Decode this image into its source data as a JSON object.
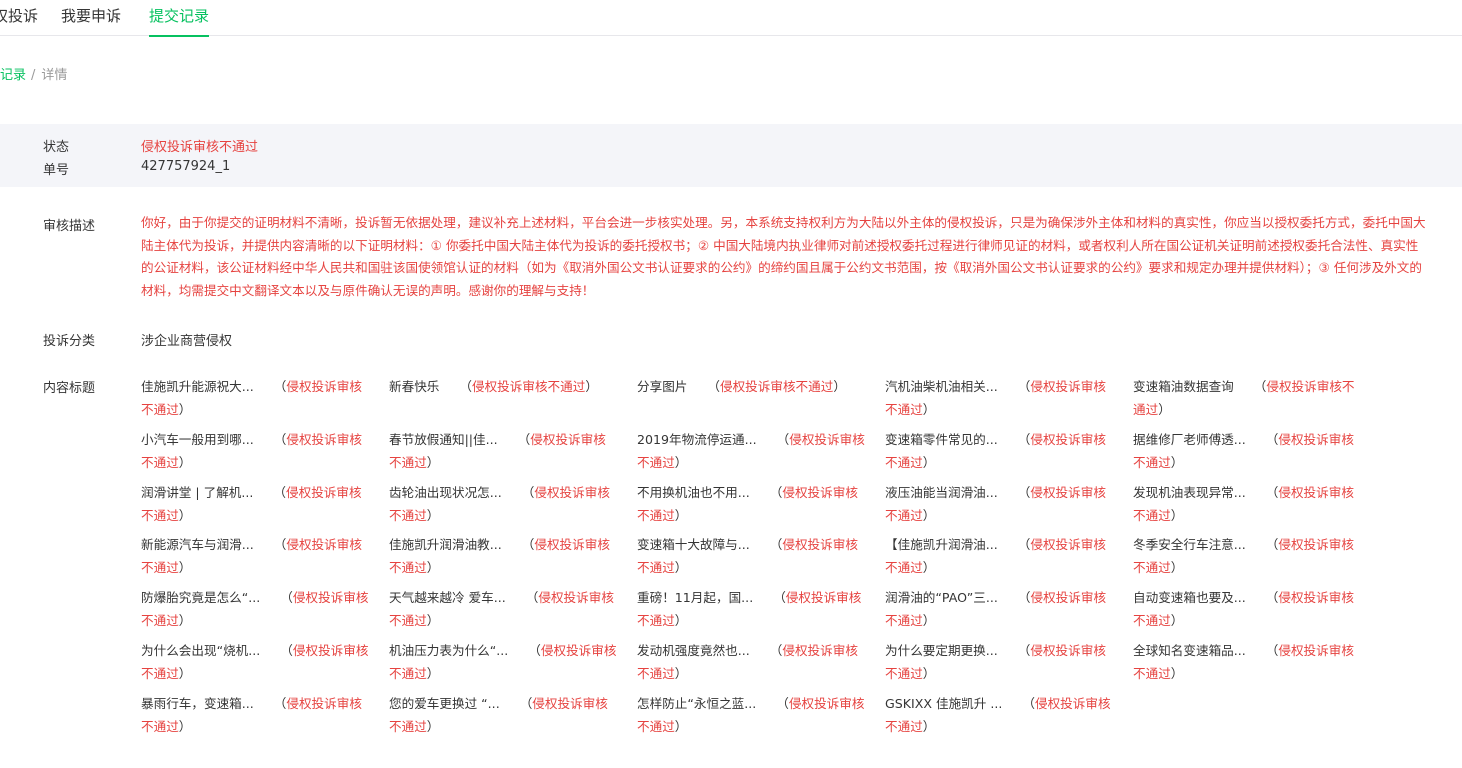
{
  "tabs": [
    {
      "label": "侵权投诉"
    },
    {
      "label": "我要申诉"
    },
    {
      "label": "提交记录"
    }
  ],
  "breadcrumb": {
    "parent": "提交记录",
    "sep": "/",
    "current": "详情"
  },
  "status": {
    "state_label": "状态",
    "state_value": "侵权投诉审核不通过",
    "number_label": "单号",
    "number_value": "427757924_1"
  },
  "review": {
    "label": "审核描述",
    "text": "你好，由于你提交的证明材料不清晰，投诉暂无依据处理，建议补充上述材料，平台会进一步核实处理。另，本系统支持权利方为大陆以外主体的侵权投诉，只是为确保涉外主体和材料的真实性，你应当以授权委托方式，委托中国大陆主体代为投诉，并提供内容清晰的以下证明材料：① 你委托中国大陆主体代为投诉的委托授权书；② 中国大陆境内执业律师对前述授权委托过程进行律师见证的材料，或者权利人所在国公证机关证明前述授权委托合法性、真实性的公证材料，该公证材料经中华人民共和国驻该国使领馆认证的材料（如为《取消外国公文书认证要求的公约》的缔约国且属于公约文书范围，按《取消外国公文书认证要求的公约》要求和规定办理并提供材料）；③ 任何涉及外文的材料，均需提交中文翻译文本以及与原件确认无误的声明。感谢你的理解与支持！"
  },
  "category": {
    "label": "投诉分类",
    "value": "涉企业商营侵权"
  },
  "titles": {
    "label": "内容标题",
    "open_paren": "（",
    "close_paren": "）",
    "items": [
      {
        "name": "佳施凯升能源祝大...",
        "status": "侵权投诉审核不通过"
      },
      {
        "name": "新春快乐",
        "status": "侵权投诉审核不通过"
      },
      {
        "name": "分享图片",
        "status": "侵权投诉审核不通过"
      },
      {
        "name": "汽机油柴机油相关...",
        "status": "侵权投诉审核不通过"
      },
      {
        "name": "变速箱油数据查询",
        "status": "侵权投诉审核不通过"
      },
      {
        "name": "小汽车一般用到哪...",
        "status": "侵权投诉审核不通过"
      },
      {
        "name": "春节放假通知||佳...",
        "status": "侵权投诉审核不通过"
      },
      {
        "name": "2019年物流停运通...",
        "status": "侵权投诉审核不通过"
      },
      {
        "name": "变速箱零件常见的...",
        "status": "侵权投诉审核不通过"
      },
      {
        "name": "据维修厂老师傅透...",
        "status": "侵权投诉审核不通过"
      },
      {
        "name": "润滑讲堂 | 了解机...",
        "status": "侵权投诉审核不通过"
      },
      {
        "name": "齿轮油出现状况怎...",
        "status": "侵权投诉审核不通过"
      },
      {
        "name": "不用换机油也不用...",
        "status": "侵权投诉审核不通过"
      },
      {
        "name": "液压油能当润滑油...",
        "status": "侵权投诉审核不通过"
      },
      {
        "name": "发现机油表现异常...",
        "status": "侵权投诉审核不通过"
      },
      {
        "name": "新能源汽车与润滑...",
        "status": "侵权投诉审核不通过"
      },
      {
        "name": "佳施凯升润滑油教...",
        "status": "侵权投诉审核不通过"
      },
      {
        "name": "变速箱十大故障与...",
        "status": "侵权投诉审核不通过"
      },
      {
        "name": "【佳施凯升润滑油...",
        "status": "侵权投诉审核不通过"
      },
      {
        "name": "冬季安全行车注意...",
        "status": "侵权投诉审核不通过"
      },
      {
        "name": "防爆胎究竟是怎么“...",
        "status": "侵权投诉审核不通过"
      },
      {
        "name": "天气越来越冷 爱车...",
        "status": "侵权投诉审核不通过"
      },
      {
        "name": "重磅！11月起，国...",
        "status": "侵权投诉审核不通过"
      },
      {
        "name": "润滑油的“PAO”三...",
        "status": "侵权投诉审核不通过"
      },
      {
        "name": "自动变速箱也要及...",
        "status": "侵权投诉审核不通过"
      },
      {
        "name": "为什么会出现“烧机...",
        "status": "侵权投诉审核不通过"
      },
      {
        "name": "机油压力表为什么“...",
        "status": "侵权投诉审核不通过"
      },
      {
        "name": "发动机强度竟然也...",
        "status": "侵权投诉审核不通过"
      },
      {
        "name": "为什么要定期更换...",
        "status": "侵权投诉审核不通过"
      },
      {
        "name": "全球知名变速箱品...",
        "status": "侵权投诉审核不通过"
      },
      {
        "name": "暴雨行车，变速箱...",
        "status": "侵权投诉审核不通过"
      },
      {
        "name": "您的爱车更换过 “...",
        "status": "侵权投诉审核不通过"
      },
      {
        "name": "怎样防止“永恒之蓝...",
        "status": "侵权投诉审核不通过"
      },
      {
        "name": "GSKIXX 佳施凯升 ...",
        "status": "侵权投诉审核不通过"
      }
    ]
  }
}
